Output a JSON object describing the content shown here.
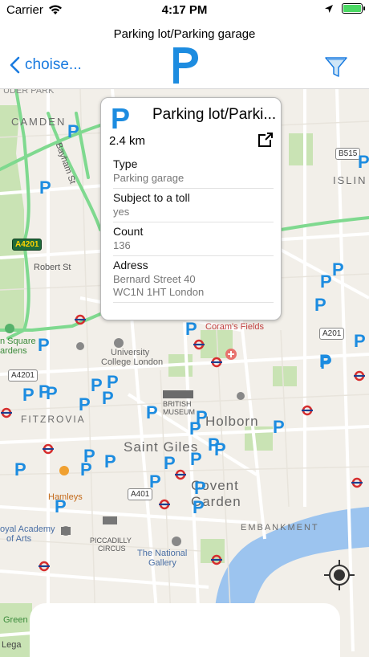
{
  "status_bar": {
    "carrier": "Carrier",
    "time": "4:17 PM"
  },
  "nav": {
    "title": "Parking lot/Parking garage",
    "back_label": "choise...",
    "logo_glyph": "P"
  },
  "colors": {
    "accent": "#1a7be0",
    "parking_blue": "#1d8ce0",
    "battery_green": "#4cd964"
  },
  "callout": {
    "glyph": "P",
    "title": "Parking lot/Parki...",
    "distance": "2.4 km",
    "rows": [
      {
        "key": "Type",
        "value": "Parking garage"
      },
      {
        "key": "Subject to a toll",
        "value": "yes"
      },
      {
        "key": "Count",
        "value": "136"
      },
      {
        "key": "Adress",
        "value_line1": "Bernard Street 40",
        "value_line2": "WC1N 1HT London"
      }
    ]
  },
  "map": {
    "labels": {
      "camden": "CAMDEN",
      "fitzrovia": "FITZROVIA",
      "saint_giles": "Saint Giles",
      "holborn": "Holborn",
      "covent": "Covent",
      "garden": "Garden",
      "embankment": "EMBANKMENT",
      "islin": "ISLIN",
      "robert_st": "Robert St",
      "bayham_st": "Bayham St",
      "corams": "Coram's Fields",
      "ucl_1": "University",
      "ucl_2": "College London",
      "british_1": "BRITISH",
      "british_2": "MUSEUM",
      "hamleys": "Hamleys",
      "piccadilly_1": "PICCADILLY",
      "piccadilly_2": "CIRCUS",
      "ngallery_1": "The National",
      "ngallery_2": "Gallery",
      "royal_1": "oyal Academy",
      "royal_2": "of Arts",
      "square_1": "n Square",
      "square_2": "ardens",
      "green": "Green",
      "legal": "Lega",
      "top_edge": "UDER PARK"
    },
    "road_signs": {
      "a4201_top": "A4201",
      "a4201_left": "A4201",
      "b515": "B515",
      "a201": "A201",
      "a401": "A401"
    },
    "pin_glyph": "P"
  }
}
